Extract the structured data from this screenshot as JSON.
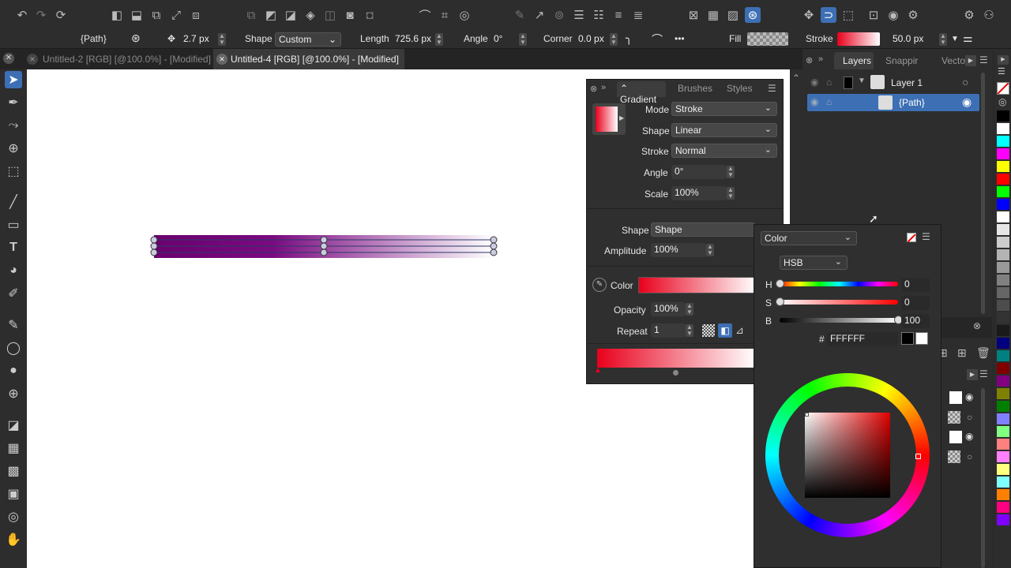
{
  "toolbar": {
    "icons": [
      "undo-icon",
      "redo-icon",
      "sync-icon",
      "flip-horizontal-icon",
      "flip-vertical-icon",
      "transform-icon",
      "resize-icon",
      "duplicate-icon",
      "boolean-add-icon",
      "boolean-subtract-icon",
      "boolean-intersect-icon",
      "boolean-xor-icon",
      "boolean-divide-icon",
      "boolean-combine-icon",
      "boolean-exclude-icon",
      "curve-icon",
      "crop-icon",
      "target-icon",
      "edit-icon",
      "export-icon",
      "circle-grid-icon",
      "align-left-icon",
      "align-bottom-icon",
      "distribute-icon",
      "distribute-alt-icon",
      "clip-icon",
      "grid-icon",
      "hatch-icon",
      "circles-icon",
      "snap-icon",
      "snap-active-icon",
      "snap-bbox-icon",
      "crop-frame-icon",
      "settings-ring-icon",
      "gear-brush-icon",
      "preferences-icon",
      "persona-icon"
    ]
  },
  "context": {
    "object": "{Path}",
    "stroke_width": "2.7 px",
    "shape_label": "Shape",
    "shape_value": "Custom",
    "length_label": "Length",
    "length_value": "725.6 px",
    "angle_label": "Angle",
    "angle_value": "0°",
    "corner_label": "Corner",
    "corner_value": "0.0 px",
    "fill_label": "Fill",
    "stroke_label": "Stroke",
    "stroke_size": "50.0 px",
    "more": "•••"
  },
  "tabs": [
    {
      "label": "Untitled-2 [RGB] [@100.0%] - [Modified]",
      "active": false
    },
    {
      "label": "Untitled-4 [RGB] [@100.0%] - [Modified]",
      "active": true
    }
  ],
  "layers": {
    "tabs": [
      "Layers",
      "Snappir",
      "Vector"
    ],
    "items": [
      {
        "name": "Layer 1"
      },
      {
        "name": "{Path}"
      }
    ]
  },
  "gradient": {
    "tabs": [
      "Gradient",
      "Brushes",
      "Styles"
    ],
    "mode_label": "Mode",
    "mode": "Stroke",
    "shape_label": "Shape",
    "shape": "Linear",
    "stroke_label": "Stroke",
    "stroke": "Normal",
    "angle_label": "Angle",
    "angle": "0°",
    "scale_label": "Scale",
    "scale": "100%",
    "shape2_label": "Shape",
    "shape2": "Shape",
    "amplitude_label": "Amplitude",
    "amplitude": "100%",
    "color_label": "Color",
    "opacity_label": "Opacity",
    "opacity": "100%",
    "repeat_label": "Repeat",
    "repeat": "1"
  },
  "color": {
    "title": "Color",
    "model": "HSB",
    "h_label": "H",
    "h": "0",
    "h_fraction": 0,
    "s_label": "S",
    "s": "0",
    "s_fraction": 0,
    "b_label": "B",
    "b": "100",
    "b_fraction": 1,
    "hash": "#",
    "hex": "FFFFFF"
  },
  "colors": {
    "accent": "#3d6fb4",
    "stroke_start": "#e8001c",
    "path_start": "#6a006e"
  },
  "palette": [
    "#000000",
    "#ffffff",
    "#00ffff",
    "#ff00ff",
    "#ffff00",
    "#ff0000",
    "#00ff00",
    "#0000ff",
    "#ffffff",
    "#e6e6e6",
    "#cccccc",
    "#b3b3b3",
    "#999999",
    "#808080",
    "#666666",
    "#4d4d4d",
    "#333333",
    "#1a1a1a",
    "#000080",
    "#008080",
    "#800000",
    "#800080",
    "#808000",
    "#008000",
    "#8080ff",
    "#80ff80",
    "#ff8080",
    "#ff80ff",
    "#ffff80",
    "#80ffff",
    "#ff8000",
    "#ff0080",
    "#8000ff"
  ]
}
